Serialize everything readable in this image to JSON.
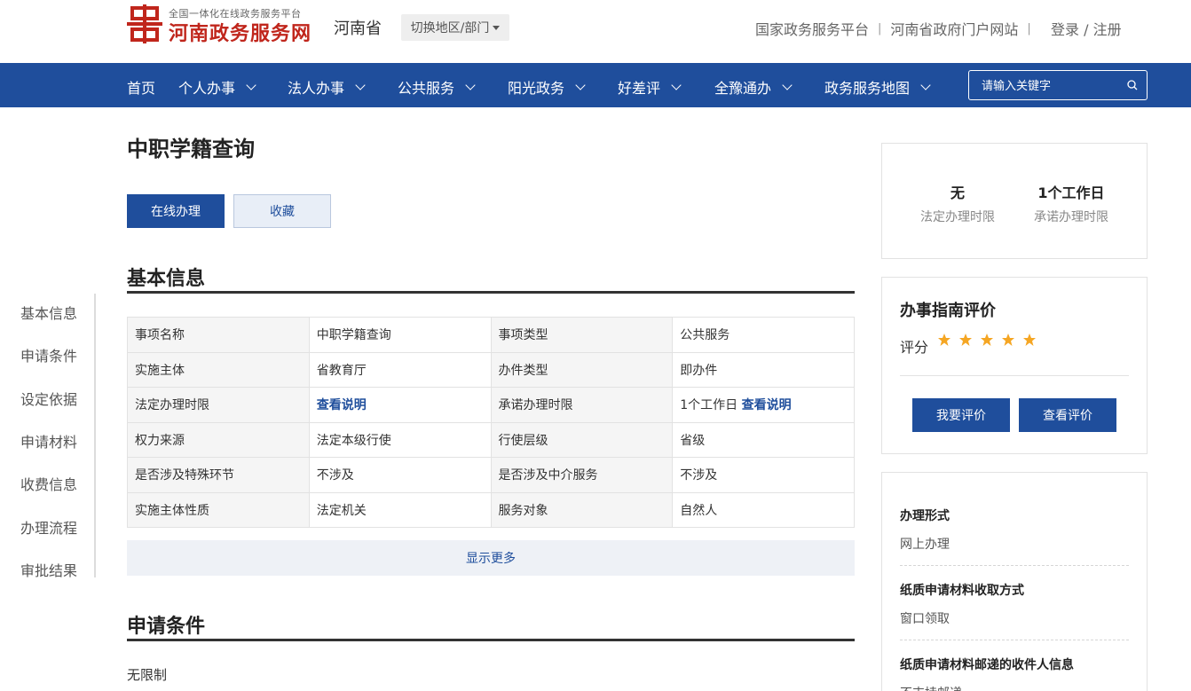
{
  "header": {
    "logo_sub": "全国一体化在线政务服务平台",
    "logo_title": "河南政务服务网",
    "province": "河南省",
    "switch_label": "切换地区/部门",
    "top_links": [
      "国家政务服务平台",
      "河南省政府门户网站"
    ],
    "login_label": "登录 / 注册",
    "logo_color": "#c0261c"
  },
  "nav": {
    "items": [
      {
        "label": "首页"
      },
      {
        "label": "个人办事"
      },
      {
        "label": "法人办事"
      },
      {
        "label": "公共服务"
      },
      {
        "label": "阳光政务"
      },
      {
        "label": "好差评"
      },
      {
        "label": "全豫通办"
      },
      {
        "label": "政务服务地图"
      }
    ],
    "search_placeholder": "请输入关键字",
    "bg_color": "#1f4e9c"
  },
  "side_nav": {
    "items": [
      "基本信息",
      "申请条件",
      "设定依据",
      "申请材料",
      "收费信息",
      "办理流程",
      "审批结果"
    ]
  },
  "main": {
    "title": "中职学籍查询",
    "online_btn": "在线办理",
    "fav_btn": "收藏",
    "basic_title": "基本信息",
    "rows": [
      [
        "事项名称",
        "中职学籍查询",
        "事项类型",
        "公共服务"
      ],
      [
        "实施主体",
        "省教育厅",
        "办件类型",
        "即办件"
      ],
      [
        "法定办理时限",
        "查看说明",
        "承诺办理时限",
        "1个工作日",
        "查看说明"
      ],
      [
        "权力来源",
        "法定本级行使",
        "行使层级",
        "省级"
      ],
      [
        "是否涉及特殊环节",
        "不涉及",
        "是否涉及中介服务",
        "不涉及"
      ],
      [
        "实施主体性质",
        "法定机关",
        "服务对象",
        "自然人"
      ]
    ],
    "show_more": "显示更多",
    "cond_title": "申请条件",
    "cond_text": "无限制"
  },
  "right": {
    "stat1_value": "无",
    "stat1_label": "法定办理时限",
    "stat2_value": "1个工作日",
    "stat2_label": "承诺办理时限",
    "eval_title": "办事指南评价",
    "rate_label": "评分",
    "stars": 5,
    "star_color": "#f5a623",
    "btn_eval": "我要评价",
    "btn_view": "查看评价",
    "items": [
      {
        "title": "办理形式",
        "value": "网上办理"
      },
      {
        "title": "纸质申请材料收取方式",
        "value": "窗口领取"
      },
      {
        "title": "纸质申请材料邮递的收件人信息",
        "value": "不支持邮递"
      }
    ]
  }
}
